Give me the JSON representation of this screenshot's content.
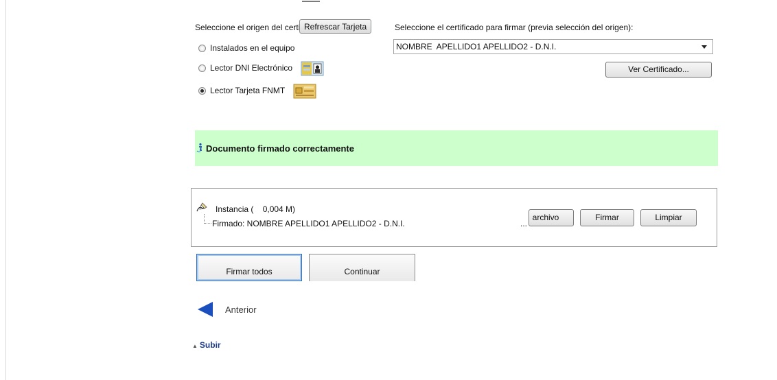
{
  "origin": {
    "label": "Seleccione el origen del certificado:",
    "refresh_button": "Refrescar Tarjeta",
    "options": [
      {
        "label": "Instalados en el equipo",
        "checked": false
      },
      {
        "label": "Lector DNI Electrónico",
        "checked": false,
        "icon": "dni-card-icon"
      },
      {
        "label": "Lector Tarjeta FNMT",
        "checked": true,
        "icon": "fnmt-card-icon"
      }
    ]
  },
  "certificate": {
    "label": "Seleccione el certificado para firmar (previa selección del origen):",
    "selected": "NOMBRE  APELLIDO1 APELLIDO2 - D.N.I.",
    "view_button": "Ver Certificado..."
  },
  "status": {
    "message": "Documento firmado correctamente",
    "icon": "info-icon",
    "color": "#ccffcc"
  },
  "document": {
    "name": "Instancia (    0,004 M)",
    "signed_by": "Firmado: NOMBRE APELLIDO1 APELLIDO2 - D.N.I.",
    "ellipsis": "...",
    "file_button": "archivo",
    "sign_button": "Firmar",
    "clear_button": "Limpiar",
    "icon": "signature-pen-icon"
  },
  "actions": {
    "sign_all": "Firmar todos",
    "continue": "Continuar"
  },
  "nav": {
    "previous": "Anterior",
    "up": "Subir"
  },
  "colors": {
    "accent_blue": "#1b4fbd",
    "success_bg": "#ccffcc"
  }
}
